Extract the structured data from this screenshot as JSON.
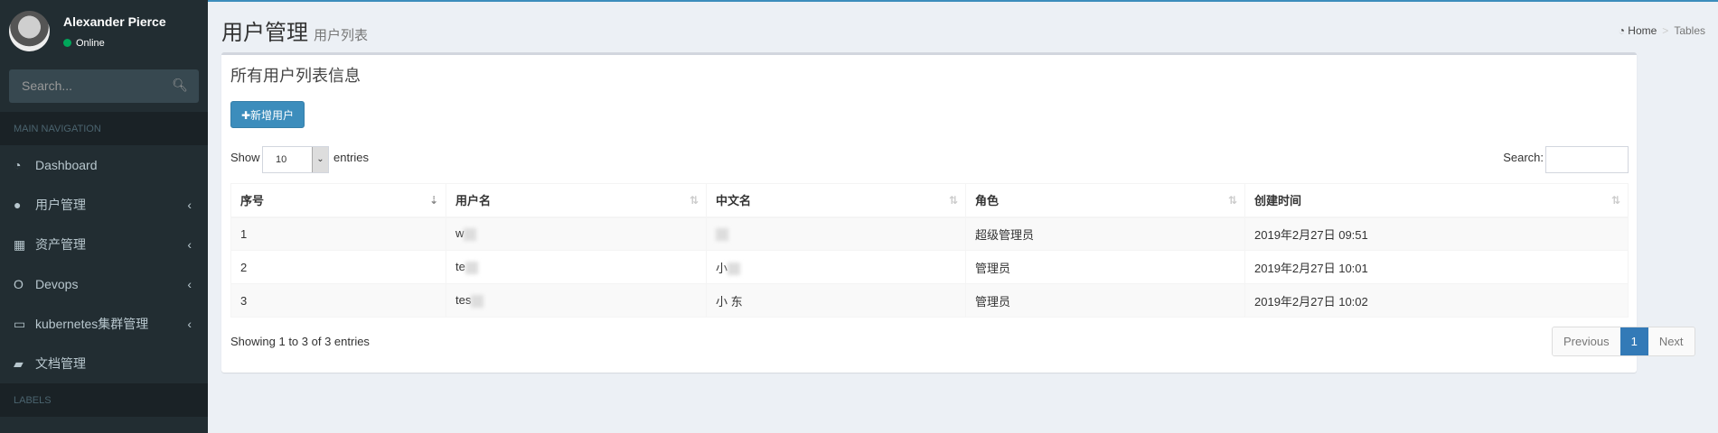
{
  "sidebar": {
    "user": {
      "name": "Alexander Pierce",
      "status": "Online"
    },
    "search_placeholder": "Search...",
    "main_nav_header": "MAIN NAVIGATION",
    "items": [
      {
        "label": "Dashboard",
        "icon": "dashboard-icon"
      },
      {
        "label": "用户管理",
        "icon": "user-icon"
      },
      {
        "label": "资产管理",
        "icon": "table-icon"
      },
      {
        "label": "Devops",
        "icon": "opera-icon"
      },
      {
        "label": "kubernetes集群管理",
        "icon": "laptop-icon"
      },
      {
        "label": "文档管理",
        "icon": "book-icon"
      }
    ],
    "labels_header": "LABELS"
  },
  "header": {
    "title": "用户管理",
    "subtitle": "用户列表",
    "breadcrumb": [
      "Home",
      "Tables"
    ]
  },
  "box": {
    "title": "所有用户列表信息",
    "add_button": "✚新增用户",
    "show_label": "Show",
    "page_size": "10",
    "entries_label": "entries",
    "search_label": "Search:",
    "search_value": "",
    "columns": [
      "序号",
      "用户名",
      "中文名",
      "角色",
      "创建时间"
    ],
    "rows": [
      [
        "1",
        "w",
        "",
        "超级管理员",
        "2019年2月27日 09:51"
      ],
      [
        "2",
        "te",
        "小",
        "管理员",
        "2019年2月27日 10:01"
      ],
      [
        "3",
        "tes",
        "小 东",
        "管理员",
        "2019年2月27日 10:02"
      ]
    ],
    "info": "Showing 1 to 3 of 3 entries",
    "pagination": {
      "previous": "Previous",
      "current": "1",
      "next": "Next"
    }
  }
}
